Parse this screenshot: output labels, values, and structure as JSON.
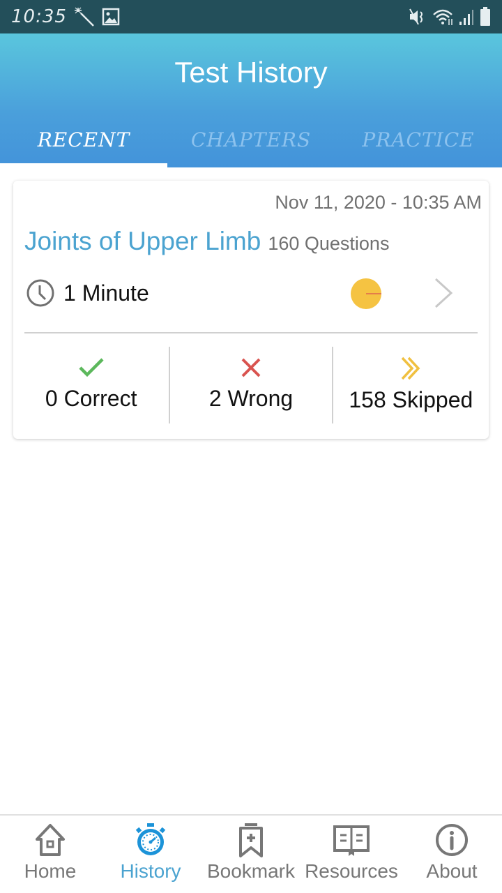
{
  "status_bar": {
    "time": "10:35",
    "left_icons": [
      "magic-wand-icon",
      "image-icon"
    ],
    "right_icons": [
      "mute-icon",
      "wifi-icon",
      "signal-icon",
      "battery-icon"
    ]
  },
  "header": {
    "title": "Test History",
    "tabs": [
      {
        "label": "RECENT",
        "active": true
      },
      {
        "label": "CHAPTERS",
        "active": false
      },
      {
        "label": "PRACTICE",
        "active": false
      }
    ]
  },
  "history": [
    {
      "date": "Nov 11, 2020 - 10:35 AM",
      "title": "Joints of Upper Limb",
      "questions": "160 Questions",
      "duration": "1 Minute",
      "score_fraction": 0.0,
      "stats": [
        {
          "label": "0 Correct",
          "icon": "check-icon",
          "color": "#5cb85c"
        },
        {
          "label": "2 Wrong",
          "icon": "cross-icon",
          "color": "#d9534f"
        },
        {
          "label": "158 Skipped",
          "icon": "double-chevron-icon",
          "color": "#f0c040"
        }
      ]
    }
  ],
  "colors": {
    "accent": "#4ba3d0",
    "pie_fill": "#f5c342",
    "pie_marker": "#d9534f",
    "header_top": "#5ac6dd",
    "header_bottom": "#4393da"
  },
  "bottom_nav": [
    {
      "label": "Home",
      "icon": "home-icon",
      "active": false
    },
    {
      "label": "History",
      "icon": "stopwatch-icon",
      "active": true
    },
    {
      "label": "Bookmark",
      "icon": "bookmark-icon",
      "active": false
    },
    {
      "label": "Resources",
      "icon": "book-icon",
      "active": false
    },
    {
      "label": "About",
      "icon": "info-icon",
      "active": false
    }
  ]
}
